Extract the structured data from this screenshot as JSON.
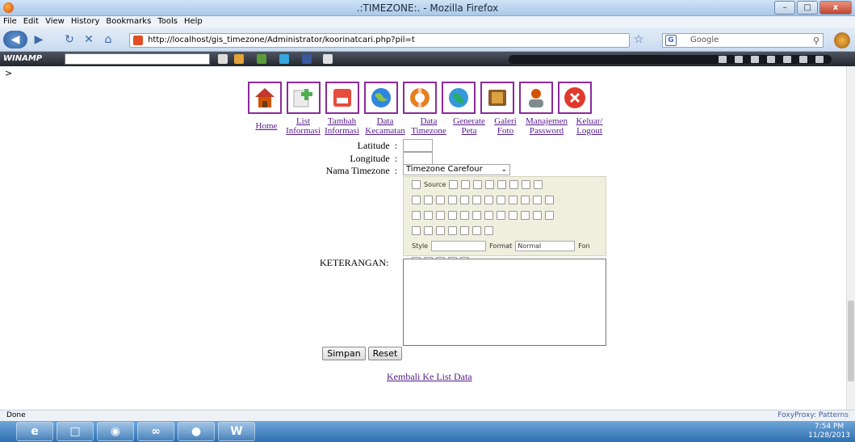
{
  "window": {
    "title": ".:TIMEZONE:. - Mozilla Firefox",
    "controls": [
      "–",
      "□",
      "x"
    ]
  },
  "menu": [
    "File",
    "Edit",
    "View",
    "History",
    "Bookmarks",
    "Tools",
    "Help"
  ],
  "nav": {
    "url": "http://localhost/gis_timezone/Administrator/koorinatcari.php?pil=t",
    "search_placeholder": "Google"
  },
  "winamp": {
    "logo": "WINAMP"
  },
  "page": {
    "breadcrumb": ">",
    "icons": [
      {
        "name": "home-icon",
        "color": "#c0392b"
      },
      {
        "name": "list-info-icon",
        "color": "#4caf50"
      },
      {
        "name": "new-info-icon",
        "color": "#e74c3c"
      },
      {
        "name": "globe-icon",
        "color": "#2e86de"
      },
      {
        "name": "lifebuoy-icon",
        "color": "#e67e22"
      },
      {
        "name": "globe-map-icon",
        "color": "#27ae60"
      },
      {
        "name": "photo-gallery-icon",
        "color": "#8e5a2b"
      },
      {
        "name": "user-manage-icon",
        "color": "#d35400"
      },
      {
        "name": "logout-icon",
        "color": "#e03a2e"
      }
    ],
    "links": [
      {
        "line1": "Home",
        "line2": ""
      },
      {
        "line1": "List",
        "line2": "Informasi"
      },
      {
        "line1": "Tambah",
        "line2": "Informasi"
      },
      {
        "line1": "Data",
        "line2": "Kecamatan"
      },
      {
        "line1": "Data",
        "line2": "Timezone"
      },
      {
        "line1": "Generate",
        "line2": "Peta"
      },
      {
        "line1": "Galeri",
        "line2": "Foto"
      },
      {
        "line1": "Manajemen",
        "line2": "Password"
      },
      {
        "line1": "Keluar/",
        "line2": "Logout"
      }
    ],
    "form": {
      "latitude_label": "Latitude",
      "longitude_label": "Longitude",
      "timezone_label": "Nama Timezone",
      "colon": ":",
      "latitude_value": "",
      "longitude_value": "",
      "timezone_selected": "Timezone Carefour",
      "keterangan_label": "KETERANGAN:",
      "editor": {
        "source_label": "Source",
        "style_label": "Style",
        "format_label": "Format",
        "format_value": "Normal",
        "font_label": "Fon"
      },
      "save_button": "Simpan",
      "reset_button": "Reset"
    },
    "back_link": "Kembali Ke List Data"
  },
  "status": {
    "left": "Done",
    "right": "FoxyProxy: Patterns"
  },
  "clock": {
    "time": "7:54 PM",
    "date": "11/28/2013"
  }
}
